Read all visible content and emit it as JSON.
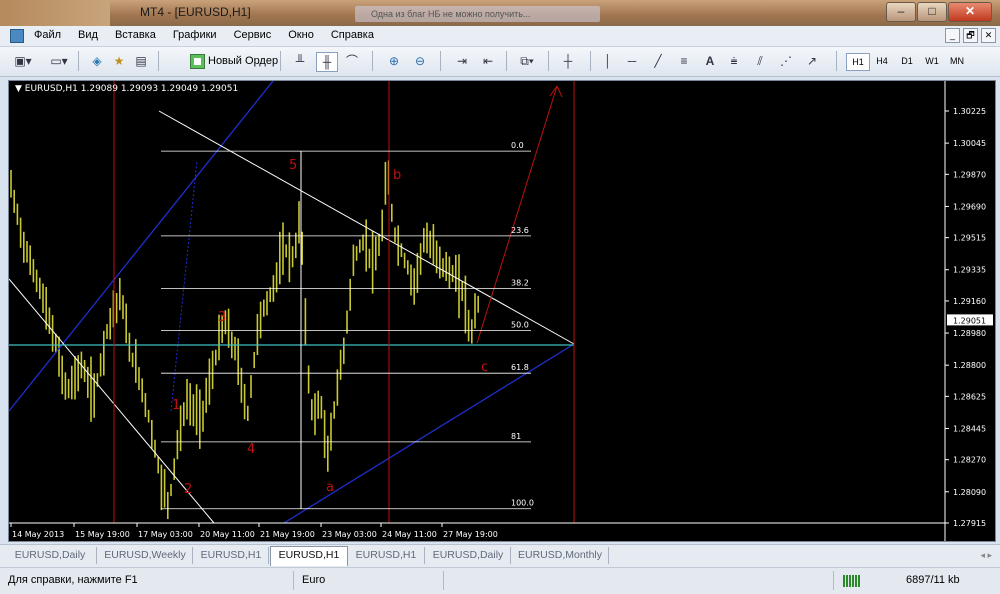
{
  "window": {
    "title": "MT4 - [EURUSD,H1]",
    "background_window_title": "Одна из благ НБ не можно получить...",
    "minimize": "–",
    "maximize": "□",
    "close": "✕"
  },
  "menu": {
    "items": [
      "Файл",
      "Вид",
      "Вставка",
      "Графики",
      "Сервис",
      "Окно",
      "Справка"
    ],
    "mdi_buttons": [
      "_",
      "🗗",
      "✕"
    ]
  },
  "toolbar": {
    "new_order_label": "Новый Ордер",
    "timeframes": [
      "H1",
      "H4",
      "D1",
      "W1",
      "MN"
    ],
    "active_timeframe": "H1",
    "draw_text_tool": "A"
  },
  "chart": {
    "info_line": "▼ EURUSD,H1  1.29089 1.29093 1.29049 1.29051",
    "current_price": "1.29051",
    "colors": {
      "background": "#000000",
      "candles": "#c8c832",
      "fib": "#ffffff",
      "trend_blue": "#1f2fd0",
      "red": "#c01010",
      "cyan_hline": "#3fbfbf"
    },
    "price_labels": [
      "1.30225",
      "1.30045",
      "1.29870",
      "1.29690",
      "1.29515",
      "1.29335",
      "1.29160",
      "1.28980",
      "1.28800",
      "1.28625",
      "1.28445",
      "1.28270",
      "1.28090",
      "1.27915"
    ],
    "time_labels": [
      "14 May 2013",
      "15 May 19:00",
      "17 May 03:00",
      "20 May 11:00",
      "21 May 19:00",
      "23 May 03:00",
      "24 May 11:00",
      "27 May 19:00"
    ],
    "fib_levels": [
      {
        "label": "0.0",
        "price": 1.3
      },
      {
        "label": "23.6",
        "price": 1.29525
      },
      {
        "label": "38.2",
        "price": 1.2923
      },
      {
        "label": "50.0",
        "price": 1.28995
      },
      {
        "label": "61.8",
        "price": 1.28755
      },
      {
        "label": "81",
        "price": 1.2837
      },
      {
        "label": "100.0",
        "price": 1.27995
      }
    ],
    "wave_labels": [
      "1",
      "2",
      "3",
      "4",
      "5",
      "a",
      "b",
      "c"
    ]
  },
  "tabs": {
    "items": [
      "EURUSD,Daily",
      "EURUSD,Weekly",
      "EURUSD,H1",
      "EURUSD,H1",
      "EURUSD,H1",
      "EURUSD,Daily",
      "EURUSD,Monthly"
    ],
    "active_index": 3,
    "nav": "◂ ▸"
  },
  "status": {
    "help": "Для справки, нажмите F1",
    "profile": "Euro",
    "traffic": "6897/11 kb"
  }
}
